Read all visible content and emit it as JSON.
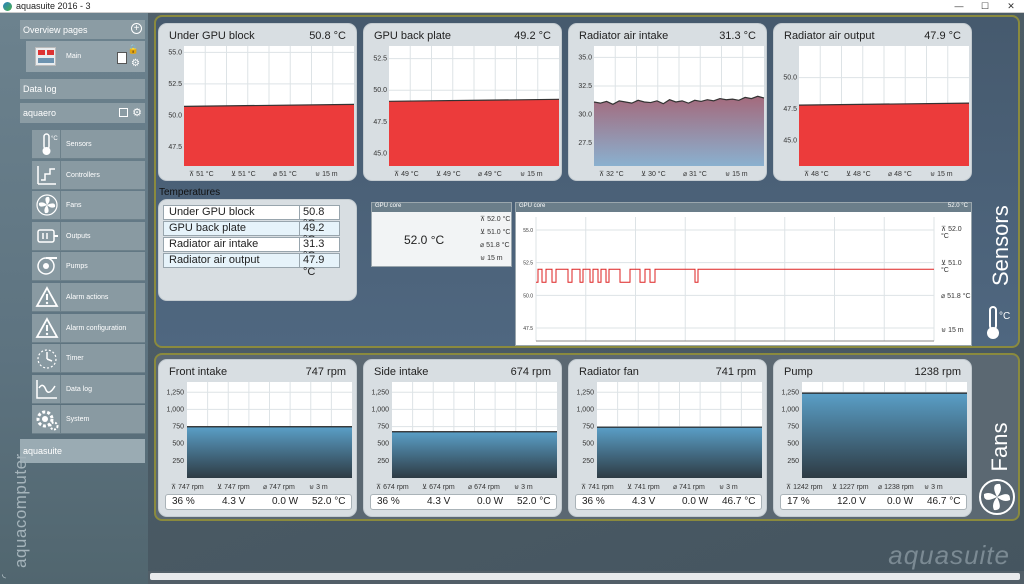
{
  "window": {
    "title": "aquasuite 2016 - 3",
    "minimize": "—",
    "maximize": "☐",
    "close": "✕"
  },
  "sidebar": {
    "overview": "Overview pages",
    "main_label": "Main",
    "datalog": "Data log",
    "aquaero": "aquaero",
    "items": [
      {
        "label": "Sensors"
      },
      {
        "label": "Controllers"
      },
      {
        "label": "Fans"
      },
      {
        "label": "Outputs"
      },
      {
        "label": "Pumps"
      },
      {
        "label": "Alarm actions"
      },
      {
        "label": "Alarm configuration"
      },
      {
        "label": "Timer"
      },
      {
        "label": "Data log"
      },
      {
        "label": "System"
      }
    ],
    "aquasuite": "aquasuite",
    "brand": "aquacomputer"
  },
  "sensors_label": "Sensors",
  "fans_label": "Fans",
  "unit_label": "°C",
  "sensor_cards": [
    {
      "title": "Under GPU block",
      "value": "50.8 °C",
      "ticks": [
        "55.0",
        "52.5",
        "50.0",
        "47.5"
      ],
      "ymin": 46,
      "ymax": 55.5,
      "level": 50.8,
      "stats": [
        "⊼ 51 °C",
        "⊻ 51 °C",
        "⌀ 51 °C",
        "⊍ 15 m"
      ]
    },
    {
      "title": "GPU back plate",
      "value": "49.2 °C",
      "ticks": [
        "52.5",
        "50.0",
        "47.5",
        "45.0"
      ],
      "ymin": 44,
      "ymax": 53.5,
      "level": 49.2,
      "stats": [
        "⊼ 49 °C",
        "⊻ 49 °C",
        "⌀ 49 °C",
        "⊍ 15 m"
      ]
    },
    {
      "title": "Radiator air intake",
      "value": "31.3 °C",
      "ticks": [
        "35.0",
        "32.5",
        "30.0",
        "27.5"
      ],
      "ymin": 25.5,
      "ymax": 36,
      "level": 31.3,
      "stats": [
        "⊼ 32 °C",
        "⊻ 30 °C",
        "⌀ 31 °C",
        "⊍ 15 m"
      ]
    },
    {
      "title": "Radiator air output",
      "value": "47.9 °C",
      "ticks": [
        "50.0",
        "47.5",
        "45.0"
      ],
      "ymin": 43,
      "ymax": 52.5,
      "level": 47.9,
      "stats": [
        "⊼ 48 °C",
        "⊻ 48 °C",
        "⌀ 48 °C",
        "⊍ 15 m"
      ]
    }
  ],
  "temperatures": {
    "heading": "Temperatures",
    "rows": [
      {
        "name": "Under GPU block",
        "value": "50.8 °C"
      },
      {
        "name": "GPU back plate",
        "value": "49.2 °C"
      },
      {
        "name": "Radiator air intake",
        "value": "31.3 °C"
      },
      {
        "name": "Radiator air output",
        "value": "47.9 °C"
      }
    ]
  },
  "gpu_small": {
    "title": "GPU core",
    "value": "52.0 °C",
    "stats": [
      "⊼ 52.0 °C",
      "⊻ 51.0 °C",
      "⌀ 51.8 °C",
      "⊍ 15 m"
    ]
  },
  "gpu_large": {
    "title": "GPU core",
    "value": "52.0 °C",
    "ticks": [
      "55.0",
      "52.5",
      "50.0",
      "47.5"
    ],
    "ymin": 46.5,
    "ymax": 56,
    "stats": [
      "⊼ 52.0 °C",
      "⊻ 51.0 °C",
      "⌀ 51.8 °C",
      "⊍ 15 m"
    ]
  },
  "fan_cards": [
    {
      "title": "Front intake",
      "value": "747 rpm",
      "ticks": [
        "1,250",
        "1,000",
        "750",
        "500",
        "250"
      ],
      "level": 747,
      "stats": [
        "⊼ 747 rpm",
        "⊻ 747 rpm",
        "⌀ 747 rpm",
        "⊍ 3 m"
      ],
      "info": [
        "36 %",
        "4.3 V",
        "0.0 W",
        "52.0 °C"
      ]
    },
    {
      "title": "Side intake",
      "value": "674 rpm",
      "ticks": [
        "1,250",
        "1,000",
        "750",
        "500",
        "250"
      ],
      "level": 674,
      "stats": [
        "⊼ 674 rpm",
        "⊻ 674 rpm",
        "⌀ 674 rpm",
        "⊍ 3 m"
      ],
      "info": [
        "36 %",
        "4.3 V",
        "0.0 W",
        "52.0 °C"
      ]
    },
    {
      "title": "Radiator fan",
      "value": "741 rpm",
      "ticks": [
        "1,250",
        "1,000",
        "750",
        "500",
        "250"
      ],
      "level": 741,
      "stats": [
        "⊼ 741 rpm",
        "⊻ 741 rpm",
        "⌀ 741 rpm",
        "⊍ 3 m"
      ],
      "info": [
        "36 %",
        "4.3 V",
        "0.0 W",
        "46.7 °C"
      ]
    },
    {
      "title": "Pump",
      "value": "1238 rpm",
      "ticks": [
        "1,250",
        "1,000",
        "750",
        "500",
        "250"
      ],
      "level": 1238,
      "stats": [
        "⊼ 1242 rpm",
        "⊻ 1227 rpm",
        "⌀ 1238 rpm",
        "⊍ 3 m"
      ],
      "info": [
        "17 %",
        "12.0 V",
        "0.0 W",
        "46.7 °C"
      ]
    }
  ],
  "watermark": "aquasuite"
}
